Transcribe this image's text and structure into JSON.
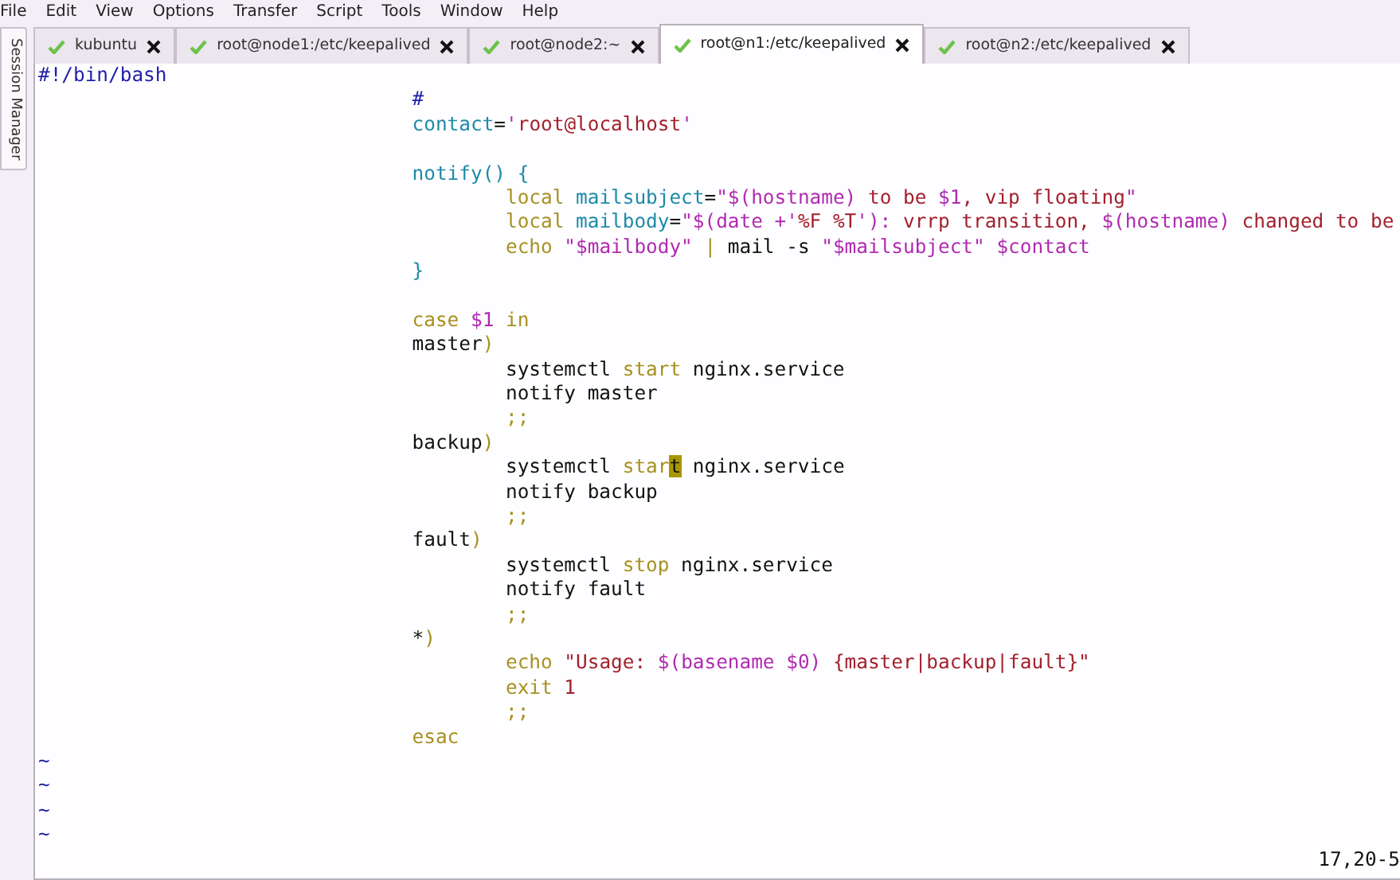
{
  "menu": [
    "File",
    "Edit",
    "View",
    "Options",
    "Transfer",
    "Script",
    "Tools",
    "Window",
    "Help"
  ],
  "tabs": [
    {
      "label": "kubuntu",
      "selected": false
    },
    {
      "label": "root@node1:/etc/keepalived",
      "selected": false
    },
    {
      "label": "root@node2:~",
      "selected": false
    },
    {
      "label": "root@n1:/etc/keepalived",
      "selected": true
    },
    {
      "label": "root@n2:/etc/keepalived",
      "selected": false
    }
  ],
  "side_tab": "Session Manager",
  "editor": {
    "lines": [
      {
        "kind": "top",
        "segs": [
          {
            "t": "#!/bin/bash",
            "kind": "comment"
          }
        ]
      },
      {
        "kind": "block",
        "segs": [
          {
            "t": "#",
            "kind": "comment"
          }
        ]
      },
      {
        "kind": "block",
        "segs": [
          {
            "t": "contact",
            "kind": "ident"
          },
          {
            "t": "=",
            "kind": "plain"
          },
          {
            "t": "'",
            "kind": "special"
          },
          {
            "t": "root@localhost",
            "kind": "string"
          },
          {
            "t": "'",
            "kind": "special"
          }
        ]
      },
      {
        "kind": "blank"
      },
      {
        "kind": "block",
        "segs": [
          {
            "t": "notify() {",
            "kind": "ident"
          }
        ]
      },
      {
        "kind": "inner",
        "segs": [
          {
            "t": "local ",
            "kind": "keyword"
          },
          {
            "t": "mailsubject",
            "kind": "ident"
          },
          {
            "t": "=",
            "kind": "plain"
          },
          {
            "t": "\"$(hostname)",
            "kind": "special"
          },
          {
            "t": " to be ",
            "kind": "string"
          },
          {
            "t": "$1",
            "kind": "special"
          },
          {
            "t": ", vip floating",
            "kind": "string"
          },
          {
            "t": "\"",
            "kind": "special"
          }
        ]
      },
      {
        "kind": "inner",
        "segs": [
          {
            "t": "local ",
            "kind": "keyword"
          },
          {
            "t": "mailbody",
            "kind": "ident"
          },
          {
            "t": "=",
            "kind": "plain"
          },
          {
            "t": "\"$(date +'",
            "kind": "special"
          },
          {
            "t": "%F %T",
            "kind": "string"
          },
          {
            "t": "'):",
            "kind": "special"
          },
          {
            "t": " vrrp transition, ",
            "kind": "string"
          },
          {
            "t": "$(hostname)",
            "kind": "special"
          },
          {
            "t": " changed to be",
            "kind": "string"
          }
        ]
      },
      {
        "kind": "inner",
        "segs": [
          {
            "t": "echo",
            "kind": "keyword"
          },
          {
            "t": " \"$mailbody\"",
            "kind": "special"
          },
          {
            "t": " | ",
            "kind": "keyword"
          },
          {
            "t": "mail -s",
            "kind": "plain"
          },
          {
            "t": " \"$mailsubject\" $contact",
            "kind": "special"
          }
        ]
      },
      {
        "kind": "block",
        "segs": [
          {
            "t": "}",
            "kind": "ident"
          }
        ]
      },
      {
        "kind": "blank"
      },
      {
        "kind": "block",
        "segs": [
          {
            "t": "case ",
            "kind": "keyword"
          },
          {
            "t": "$1",
            "kind": "special"
          },
          {
            "t": " in",
            "kind": "keyword"
          }
        ]
      },
      {
        "kind": "block",
        "segs": [
          {
            "t": "master",
            "kind": "plain"
          },
          {
            "t": ")",
            "kind": "keyword"
          }
        ]
      },
      {
        "kind": "inner",
        "segs": [
          {
            "t": "systemctl ",
            "kind": "plain"
          },
          {
            "t": "start",
            "kind": "keyword"
          },
          {
            "t": " nginx.service",
            "kind": "plain"
          }
        ]
      },
      {
        "kind": "inner",
        "segs": [
          {
            "t": "notify master",
            "kind": "plain"
          }
        ]
      },
      {
        "kind": "inner",
        "segs": [
          {
            "t": ";;",
            "kind": "keyword"
          }
        ]
      },
      {
        "kind": "block",
        "segs": [
          {
            "t": "backup",
            "kind": "plain"
          },
          {
            "t": ")",
            "kind": "keyword"
          }
        ]
      },
      {
        "kind": "inner",
        "segs": [
          {
            "t": "systemctl ",
            "kind": "plain"
          },
          {
            "t": "star",
            "kind": "keyword"
          },
          {
            "t": "t",
            "kind": "cursor"
          },
          {
            "t": " nginx.service",
            "kind": "plain"
          }
        ]
      },
      {
        "kind": "inner",
        "segs": [
          {
            "t": "notify backup",
            "kind": "plain"
          }
        ]
      },
      {
        "kind": "inner",
        "segs": [
          {
            "t": ";;",
            "kind": "keyword"
          }
        ]
      },
      {
        "kind": "block",
        "segs": [
          {
            "t": "fault",
            "kind": "plain"
          },
          {
            "t": ")",
            "kind": "keyword"
          }
        ]
      },
      {
        "kind": "inner",
        "segs": [
          {
            "t": "systemctl ",
            "kind": "plain"
          },
          {
            "t": "stop",
            "kind": "keyword"
          },
          {
            "t": " nginx.service",
            "kind": "plain"
          }
        ]
      },
      {
        "kind": "inner",
        "segs": [
          {
            "t": "notify fault",
            "kind": "plain"
          }
        ]
      },
      {
        "kind": "inner",
        "segs": [
          {
            "t": ";;",
            "kind": "keyword"
          }
        ]
      },
      {
        "kind": "block",
        "segs": [
          {
            "t": "*",
            "kind": "plain"
          },
          {
            "t": ")",
            "kind": "keyword"
          }
        ]
      },
      {
        "kind": "inner",
        "segs": [
          {
            "t": "echo",
            "kind": "keyword"
          },
          {
            "t": " \"Usage: ",
            "kind": "string"
          },
          {
            "t": "$(basename $0)",
            "kind": "special"
          },
          {
            "t": " {master|backup|fault}\"",
            "kind": "string"
          }
        ]
      },
      {
        "kind": "inner",
        "segs": [
          {
            "t": "exit",
            "kind": "keyword"
          },
          {
            "t": " 1",
            "kind": "string"
          }
        ]
      },
      {
        "kind": "inner",
        "segs": [
          {
            "t": ";;",
            "kind": "keyword"
          }
        ]
      },
      {
        "kind": "block",
        "segs": [
          {
            "t": "esac",
            "kind": "keyword"
          }
        ]
      }
    ],
    "tildes": [
      "~",
      "~",
      "~",
      "~"
    ],
    "position": "17,20-5"
  }
}
